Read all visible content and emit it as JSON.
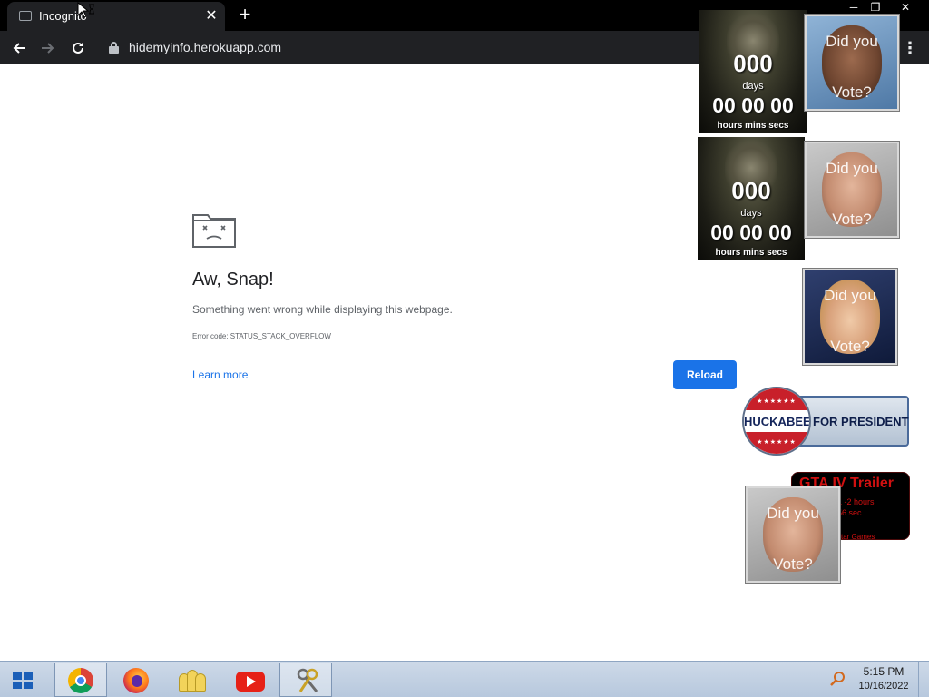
{
  "browser": {
    "tab_title": "Incognito",
    "new_tab_symbol": "+",
    "tab_close_symbol": "✕",
    "url": "hidemyinfo.herokuapp.com",
    "window_controls": [
      "─",
      "❐",
      "✕"
    ],
    "menu_symbol": "⋮"
  },
  "error_page": {
    "title": "Aw, Snap!",
    "message": "Something went wrong while displaying this webpage.",
    "error_code": "Error code: STATUS_STACK_OVERFLOW",
    "learn_more": "Learn more",
    "reload": "Reload",
    "colors": {
      "accent": "#1a73e8",
      "title": "#202124",
      "text": "#5f6368"
    }
  },
  "ads": {
    "countdowns": [
      {
        "days": "000",
        "days_label": "days",
        "time": "00 00 00",
        "units": "hours mins secs"
      },
      {
        "days": "000",
        "days_label": "days",
        "time": "00 00 00",
        "units": "hours mins secs"
      }
    ],
    "vote_popups": [
      {
        "line1": "Did you",
        "line2": "Vote?"
      },
      {
        "line1": "Did you",
        "line2": "Vote?"
      },
      {
        "line1": "Did you",
        "line2": "Vote?"
      },
      {
        "line1": "Did you",
        "line2": "Vote?"
      }
    ],
    "huckabee": {
      "name": "HUCKABEE",
      "tagline": "FOR PRESIDENT",
      "stars": "★★★★★★"
    },
    "gta": {
      "title": "GTA IV Trailer",
      "line1": "1 -2 hours",
      "line2": "56 sec",
      "line3": "star Games"
    }
  },
  "taskbar": {
    "apps": [
      "chrome",
      "firefox",
      "file-explorer",
      "youtube",
      "keys"
    ],
    "clock_time": "5:15 PM",
    "clock_date": "10/16/2022"
  },
  "colors": {
    "tabstrip": "#000000",
    "toolbar": "#202124",
    "reload_button": "#1a73e8",
    "gta_red": "#d01010",
    "taskbar": "#c3d2e5"
  }
}
